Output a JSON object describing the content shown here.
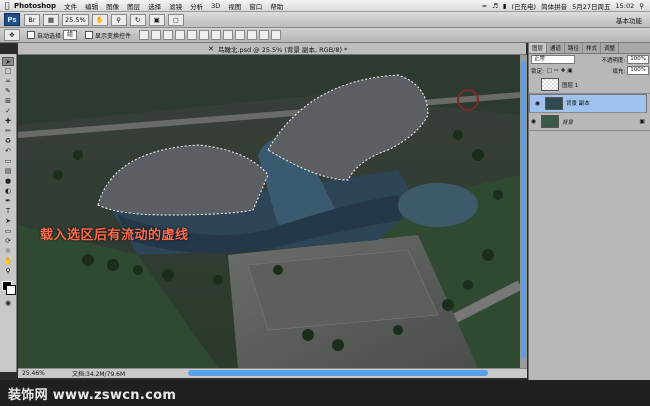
{
  "menubar": {
    "app_name": "Photoshop",
    "items": [
      "文件",
      "编辑",
      "图像",
      "图层",
      "选择",
      "滤镜",
      "分析",
      "3D",
      "视图",
      "窗口",
      "帮助"
    ],
    "battery": "(已充电)",
    "input_method": "简体拼音",
    "date": "5月27日周五",
    "time": "15:02"
  },
  "appbar": {
    "logo": "Ps",
    "zoom": "25.5%",
    "workspace": "基本功能"
  },
  "options": {
    "auto_select": "自动选择:",
    "auto_select_value": "组",
    "show_transform": "显示变换控件"
  },
  "document": {
    "tab_title": "鸟瞰北.psd @ 25.5% (背景 副本, RGB/8) *",
    "annotation": "载入选区后有流动的虚线"
  },
  "status": {
    "zoom": "25.46%",
    "doc_info": "文档:34.2M/79.6M"
  },
  "panels": {
    "tabs": [
      "图层",
      "通道",
      "路径",
      "样式",
      "调整"
    ],
    "blend_mode": "正常",
    "opacity_label": "不透明度:",
    "opacity": "100%",
    "lock_label": "锁定:",
    "fill_label": "填充:",
    "fill": "100%",
    "layers": [
      {
        "name": "图层 1"
      },
      {
        "name": "背景 副本"
      },
      {
        "name": "背景"
      }
    ]
  },
  "watermark": "装饰网 www.zswcn.com",
  "colors": {
    "selection_blue": "#5aa0e8",
    "annotation_red": "#ff6a4a"
  }
}
